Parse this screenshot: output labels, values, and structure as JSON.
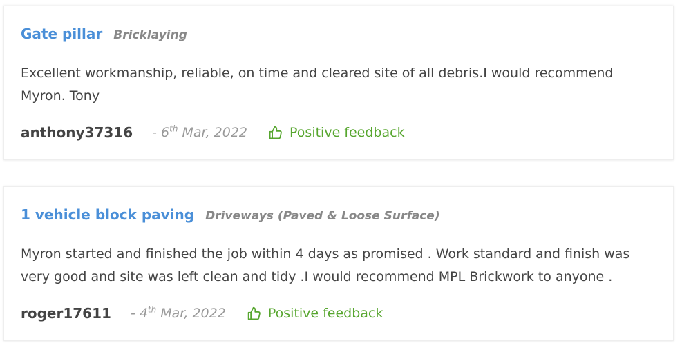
{
  "reviews": [
    {
      "title": "Gate pillar",
      "category": "Bricklaying",
      "text_line1": "Excellent workmanship, reliable, on time and cleared site of all debris.I would recommend",
      "text_line2": "Myron. Tony",
      "username": "anthony37316",
      "date_prefix": "- 6",
      "date_suffix": "th",
      "date_rest": " Mar, 2022",
      "feedback": "Positive feedback",
      "feedback_icon": "thumbs-up-icon"
    },
    {
      "title": "1 vehicle block paving",
      "category": "Driveways (Paved & Loose Surface)",
      "text_line1": "Myron started and finished the job within 4 days as promised . Work standard and finish was",
      "text_line2": "very good and site was left clean and tidy .I would recommend MPL Brickwork to anyone .",
      "username": "roger17611",
      "date_prefix": "- 4",
      "date_suffix": "th",
      "date_rest": " Mar, 2022",
      "feedback": "Positive feedback",
      "feedback_icon": "thumbs-up-icon"
    }
  ],
  "colors": {
    "title": "#4a8fd8",
    "positive": "#57a62f",
    "muted": "#999999",
    "text": "#444444"
  }
}
